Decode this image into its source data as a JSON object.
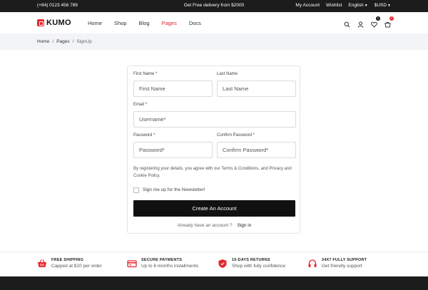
{
  "topbar": {
    "phone": "(+84) 0123 456 789",
    "promo": "Get Free delivery from $2000",
    "account": "My Account",
    "wishlist": "Wishlist",
    "language": "English",
    "currency": "$USD"
  },
  "header": {
    "logo": "KUMO",
    "nav": [
      "Home",
      "Shop",
      "Blog",
      "Pages",
      "Docs"
    ],
    "active_nav": "Pages",
    "wishlist_count": "0",
    "cart_count": "0"
  },
  "breadcrumb": [
    "Home",
    "Pages",
    "SignUp"
  ],
  "form": {
    "first_name_label": "First Name *",
    "first_name_placeholder": "First Name",
    "last_name_label": "Last Name",
    "last_name_placeholder": "Last Name",
    "email_label": "Email *",
    "email_placeholder": "Username*",
    "password_label": "Password *",
    "password_placeholder": "Password*",
    "confirm_label": "Confirm Password *",
    "confirm_placeholder": "Confirm Password*",
    "terms": "By registering your details, you agree with our Terms & Conditions, and Privacy and Cookie Policy.",
    "newsletter": "Sign me up for the Newsletter!",
    "submit": "Create An Account",
    "already": "Already have an account ?",
    "signin": "Sign in"
  },
  "features": [
    {
      "title": "FREE SHIPPING",
      "sub": "Capped at $10 per order",
      "icon": "basket-icon"
    },
    {
      "title": "SECURE PAYMENTS",
      "sub": "Up to 6 months installments",
      "icon": "card-icon"
    },
    {
      "title": "15-DAYS RETURNS",
      "sub": "Shop with fully confidence",
      "icon": "shield-icon"
    },
    {
      "title": "24X7 FULLY SUPPORT",
      "sub": "Get friendly support",
      "icon": "headset-icon"
    }
  ],
  "colors": {
    "accent": "#e5262b",
    "dark": "#1c1c1c",
    "button": "#111111"
  }
}
